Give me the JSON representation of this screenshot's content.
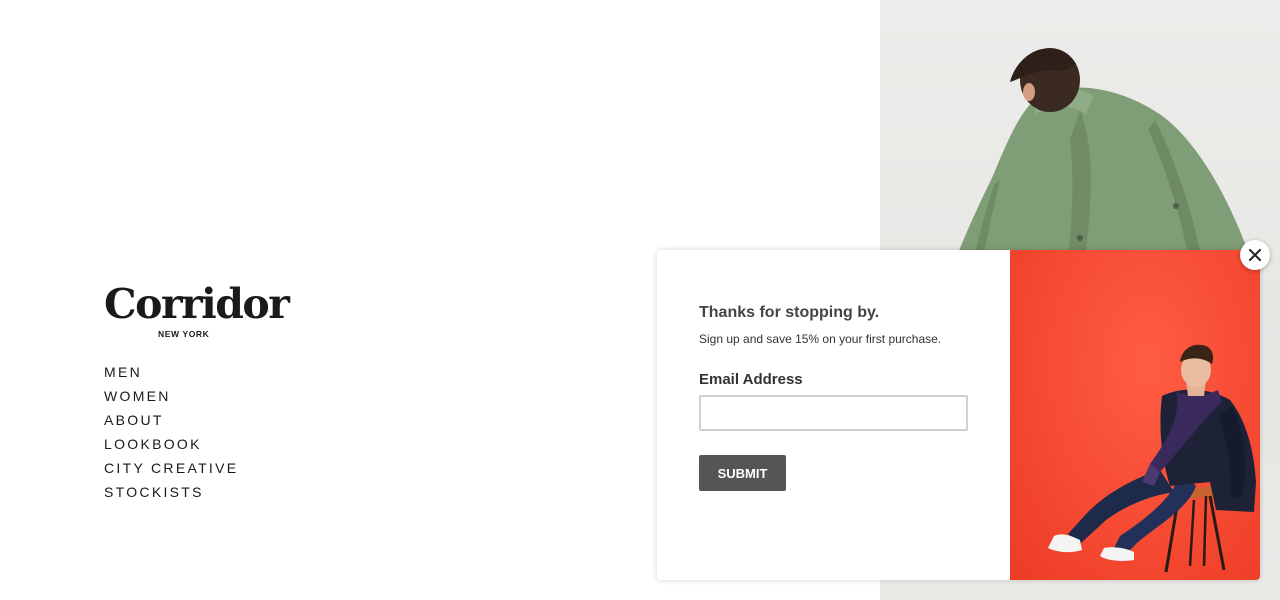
{
  "brand": {
    "name": "Corridor",
    "location": "NEW YORK"
  },
  "nav": {
    "items": [
      {
        "label": "MEN"
      },
      {
        "label": "WOMEN"
      },
      {
        "label": "ABOUT"
      },
      {
        "label": "LOOKBOOK"
      },
      {
        "label": "CITY CREATIVE"
      },
      {
        "label": "STOCKISTS"
      }
    ]
  },
  "popup": {
    "title": "Thanks for stopping by.",
    "subtitle": "Sign up and save 15% on your first purchase.",
    "email_label": "Email Address",
    "email_value": "",
    "email_placeholder": "",
    "submit_label": "SUBMIT",
    "close_icon": "close-icon",
    "accent_color": "#555555",
    "image_background": "#f64a33"
  },
  "hero": {
    "background": "#ececea",
    "jacket_color": "#7f9d76"
  }
}
